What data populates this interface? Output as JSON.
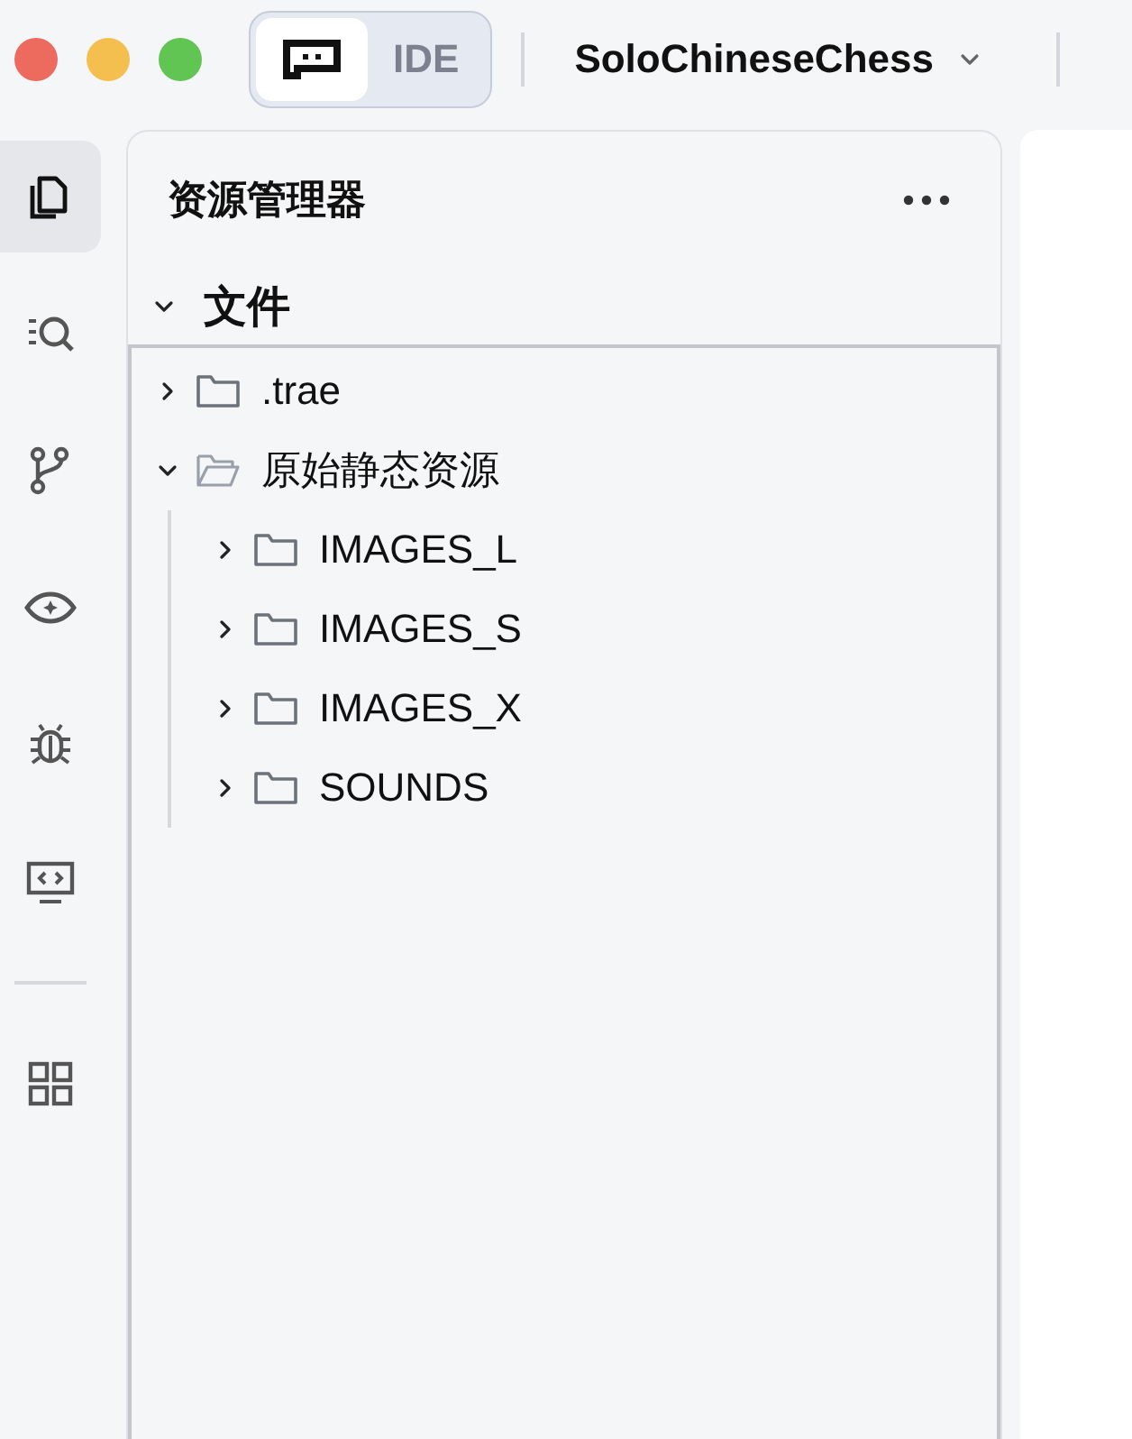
{
  "title_bar": {
    "mode_switch": [
      {
        "kind": "icon",
        "selected": true
      },
      {
        "kind": "text",
        "label": "IDE",
        "selected": false
      }
    ],
    "project": {
      "name": "SoloChineseChess"
    }
  },
  "activity_bar": {
    "items": [
      {
        "kind": "files",
        "selected": true
      },
      {
        "kind": "search",
        "selected": false
      },
      {
        "kind": "source-control",
        "selected": false
      },
      {
        "kind": "preview",
        "selected": false
      },
      {
        "kind": "debug",
        "selected": false
      },
      {
        "kind": "remote",
        "selected": false
      }
    ],
    "bottom_items": [
      {
        "kind": "extensions",
        "selected": false
      }
    ]
  },
  "explorer": {
    "title": "资源管理器",
    "section": {
      "title": "文件",
      "expanded": true
    },
    "tree": [
      {
        "name": ".trae",
        "expanded": false
      },
      {
        "name": "原始静态资源",
        "expanded": true,
        "children": [
          {
            "name": "IMAGES_L",
            "expanded": false
          },
          {
            "name": "IMAGES_S",
            "expanded": false
          },
          {
            "name": "IMAGES_X",
            "expanded": false
          },
          {
            "name": "SOUNDS",
            "expanded": false
          }
        ]
      }
    ]
  }
}
